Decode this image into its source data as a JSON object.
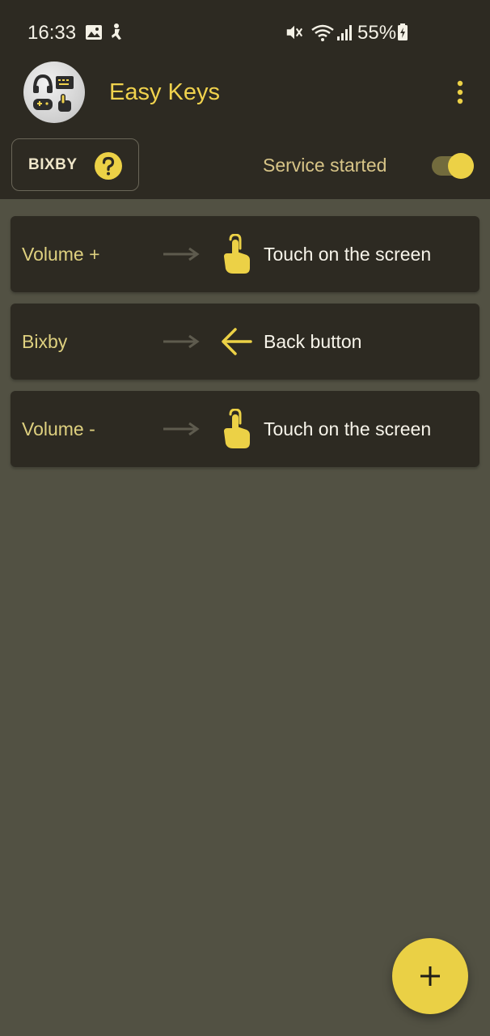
{
  "status_bar": {
    "time": "16:33",
    "battery_percent": "55%",
    "icons": [
      "gallery-icon",
      "accessibility-icon",
      "mute-icon",
      "wifi-icon",
      "signal-icon",
      "battery-charging-icon"
    ]
  },
  "app_bar": {
    "title": "Easy Keys",
    "logo_icon": "easy-keys-logo-icon",
    "menu_icon": "more-vert-icon"
  },
  "controls": {
    "key_chip_label": "BIXBY",
    "help_icon": "help-icon",
    "service_label": "Service started",
    "service_enabled": true
  },
  "mappings": [
    {
      "key": "Volume +",
      "arrow_icon": "arrow-right-icon",
      "action_icon": "touch-icon",
      "action": "Touch on the screen"
    },
    {
      "key": "Bixby",
      "arrow_icon": "arrow-right-icon",
      "action_icon": "back-arrow-icon",
      "action": "Back button"
    },
    {
      "key": "Volume -",
      "arrow_icon": "arrow-right-icon",
      "action_icon": "touch-icon",
      "action": "Touch on the screen"
    }
  ],
  "fab": {
    "icon": "plus-icon"
  },
  "colors": {
    "background": "#525143",
    "surface": "#2d2a22",
    "accent": "#ecd146",
    "key_text": "#ded07f",
    "primary_text": "#f7f4ea"
  }
}
